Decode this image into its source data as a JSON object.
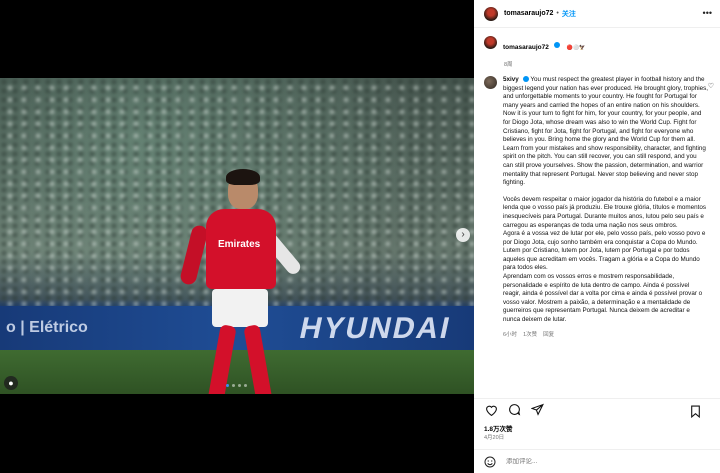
{
  "header": {
    "username": "tomasaraujo72",
    "separator": "•",
    "follow_label": "关注",
    "more_icon": "more-horizontal-icon"
  },
  "post": {
    "username": "tomasaraujo72",
    "emojis": "🔴⚪🦅",
    "time": "8周"
  },
  "photo": {
    "board_left": "o | Elétrico",
    "board_right": "HYUNDAI",
    "sponsor": "Emirates"
  },
  "comment": {
    "username": "5xivy",
    "text_en": "You must respect the greatest player in football history and the biggest legend your nation has ever produced. He brought glory, trophies, and unforgettable moments to your country. He fought for Portugal for many years and carried the hopes of an entire nation on his shoulders.\nNow it is your turn to fight for him, for your country, for your people, and for Diogo Jota, whose dream was also to win the World Cup. Fight for Cristiano, fight for Jota, fight for Portugal, and fight for everyone who believes in you. Bring home the glory and the World Cup for them all.\nLearn from your mistakes and show responsibility, character, and fighting spirit on the pitch. You can still recover, you can still respond, and you can still prove yourselves. Show the passion, determination, and warrior mentality that represent Portugal. Never stop believing and never stop fighting.",
    "text_pt": "Vocês devem respeitar o maior jogador da história do futebol e a maior lenda que o vosso país já produziu. Ele trouxe glória, títulos e momentos inesquecíveis para Portugal. Durante muitos anos, lutou pelo seu país e carregou as esperanças de toda uma nação nos seus ombros.\nAgora é a vossa vez de lutar por ele, pelo vosso país, pelo vosso povo e por Diogo Jota, cujo sonho também era conquistar a Copa do Mundo. Lutem por Cristiano, lutem por Jota, lutem por Portugal e por todos aqueles que acreditam em vocês. Tragam a glória e a Copa do Mundo para todos eles.\nAprendam com os vossos erros e mostrem responsabilidade, personalidade e espírito de luta dentro de campo. Ainda é possível reagir, ainda é possível dar a volta por cima e ainda é possível provar o vosso valor. Mostrem a paixão, a determinação e a mentalidade de guerreiros que representam Portugal. Nunca deixem de acreditar e nunca deixem de lutar.",
    "time": "6小时",
    "likes": "1次赞",
    "reply_label": "回复"
  },
  "stats": {
    "likes": "1.8万次赞",
    "date": "4月20日"
  },
  "input": {
    "placeholder": "添加评论..."
  },
  "icons": {
    "like": "heart-icon",
    "comment": "comment-icon",
    "share": "share-icon",
    "save": "bookmark-icon",
    "emoji": "smile-icon"
  },
  "colors": {
    "accent": "#0095f6",
    "jersey": "#d3102a"
  }
}
